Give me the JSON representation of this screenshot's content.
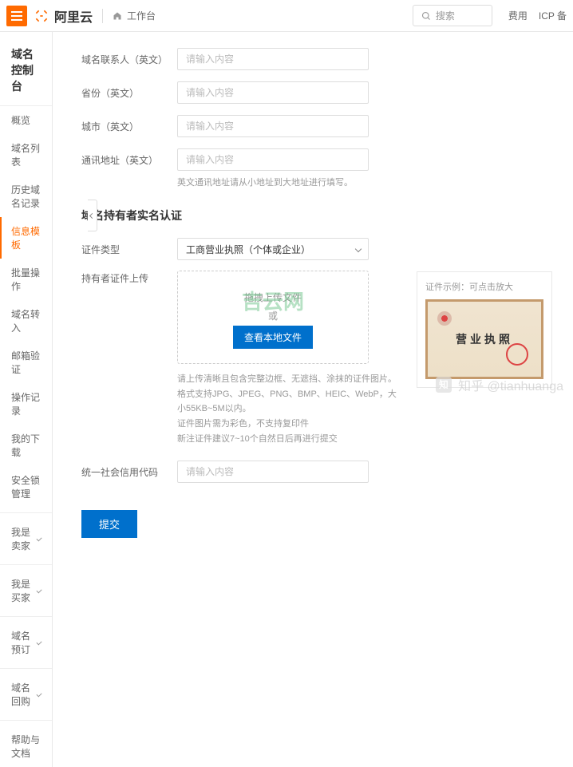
{
  "header": {
    "brand": "阿里云",
    "workbench": "工作台",
    "search_placeholder": "搜索",
    "link_fee": "费用",
    "link_icp": "ICP 备"
  },
  "sidebar": {
    "title": "域名控制台",
    "items": [
      "概览",
      "域名列表",
      "历史域名记录",
      "信息模板",
      "批量操作",
      "域名转入",
      "邮箱验证",
      "操作记录",
      "我的下载",
      "安全锁管理"
    ],
    "groups": [
      "我是卖家",
      "我是买家",
      "域名预订",
      "域名回购",
      "帮助与文档"
    ]
  },
  "form": {
    "contact_label": "域名联系人（英文）",
    "province_label": "省份（英文）",
    "city_label": "城市（英文）",
    "address_label": "通讯地址（英文）",
    "placeholder": "请输入内容",
    "address_hint": "英文通讯地址请从小地址到大地址进行填写。"
  },
  "auth": {
    "section_title": "域名持有者实名认证",
    "cert_type_label": "证件类型",
    "cert_type_value": "工商营业执照（个体或企业）",
    "upload_label": "持有者证件上传",
    "watermark": "吉云网",
    "upload_text": "拖拽上传文件",
    "upload_or": "或",
    "upload_btn": "查看本地文件",
    "hint1": "请上传清晰且包含完整边框、无遮挡、涂抹的证件图片。",
    "hint2": "格式支持JPG、JPEG、PNG、BMP、HEIC、WebP，大小55KB~5M以内。",
    "hint3": "证件图片需为彩色，不支持复印件",
    "hint4": "新注证件建议7~10个自然日后再进行提交",
    "example_title": "证件示例：可点击放大",
    "cert_title": "营业执照",
    "credit_code_label": "统一社会信用代码",
    "submit": "提交"
  },
  "watermark": {
    "zhihu": "知乎 @tianhuanga"
  }
}
